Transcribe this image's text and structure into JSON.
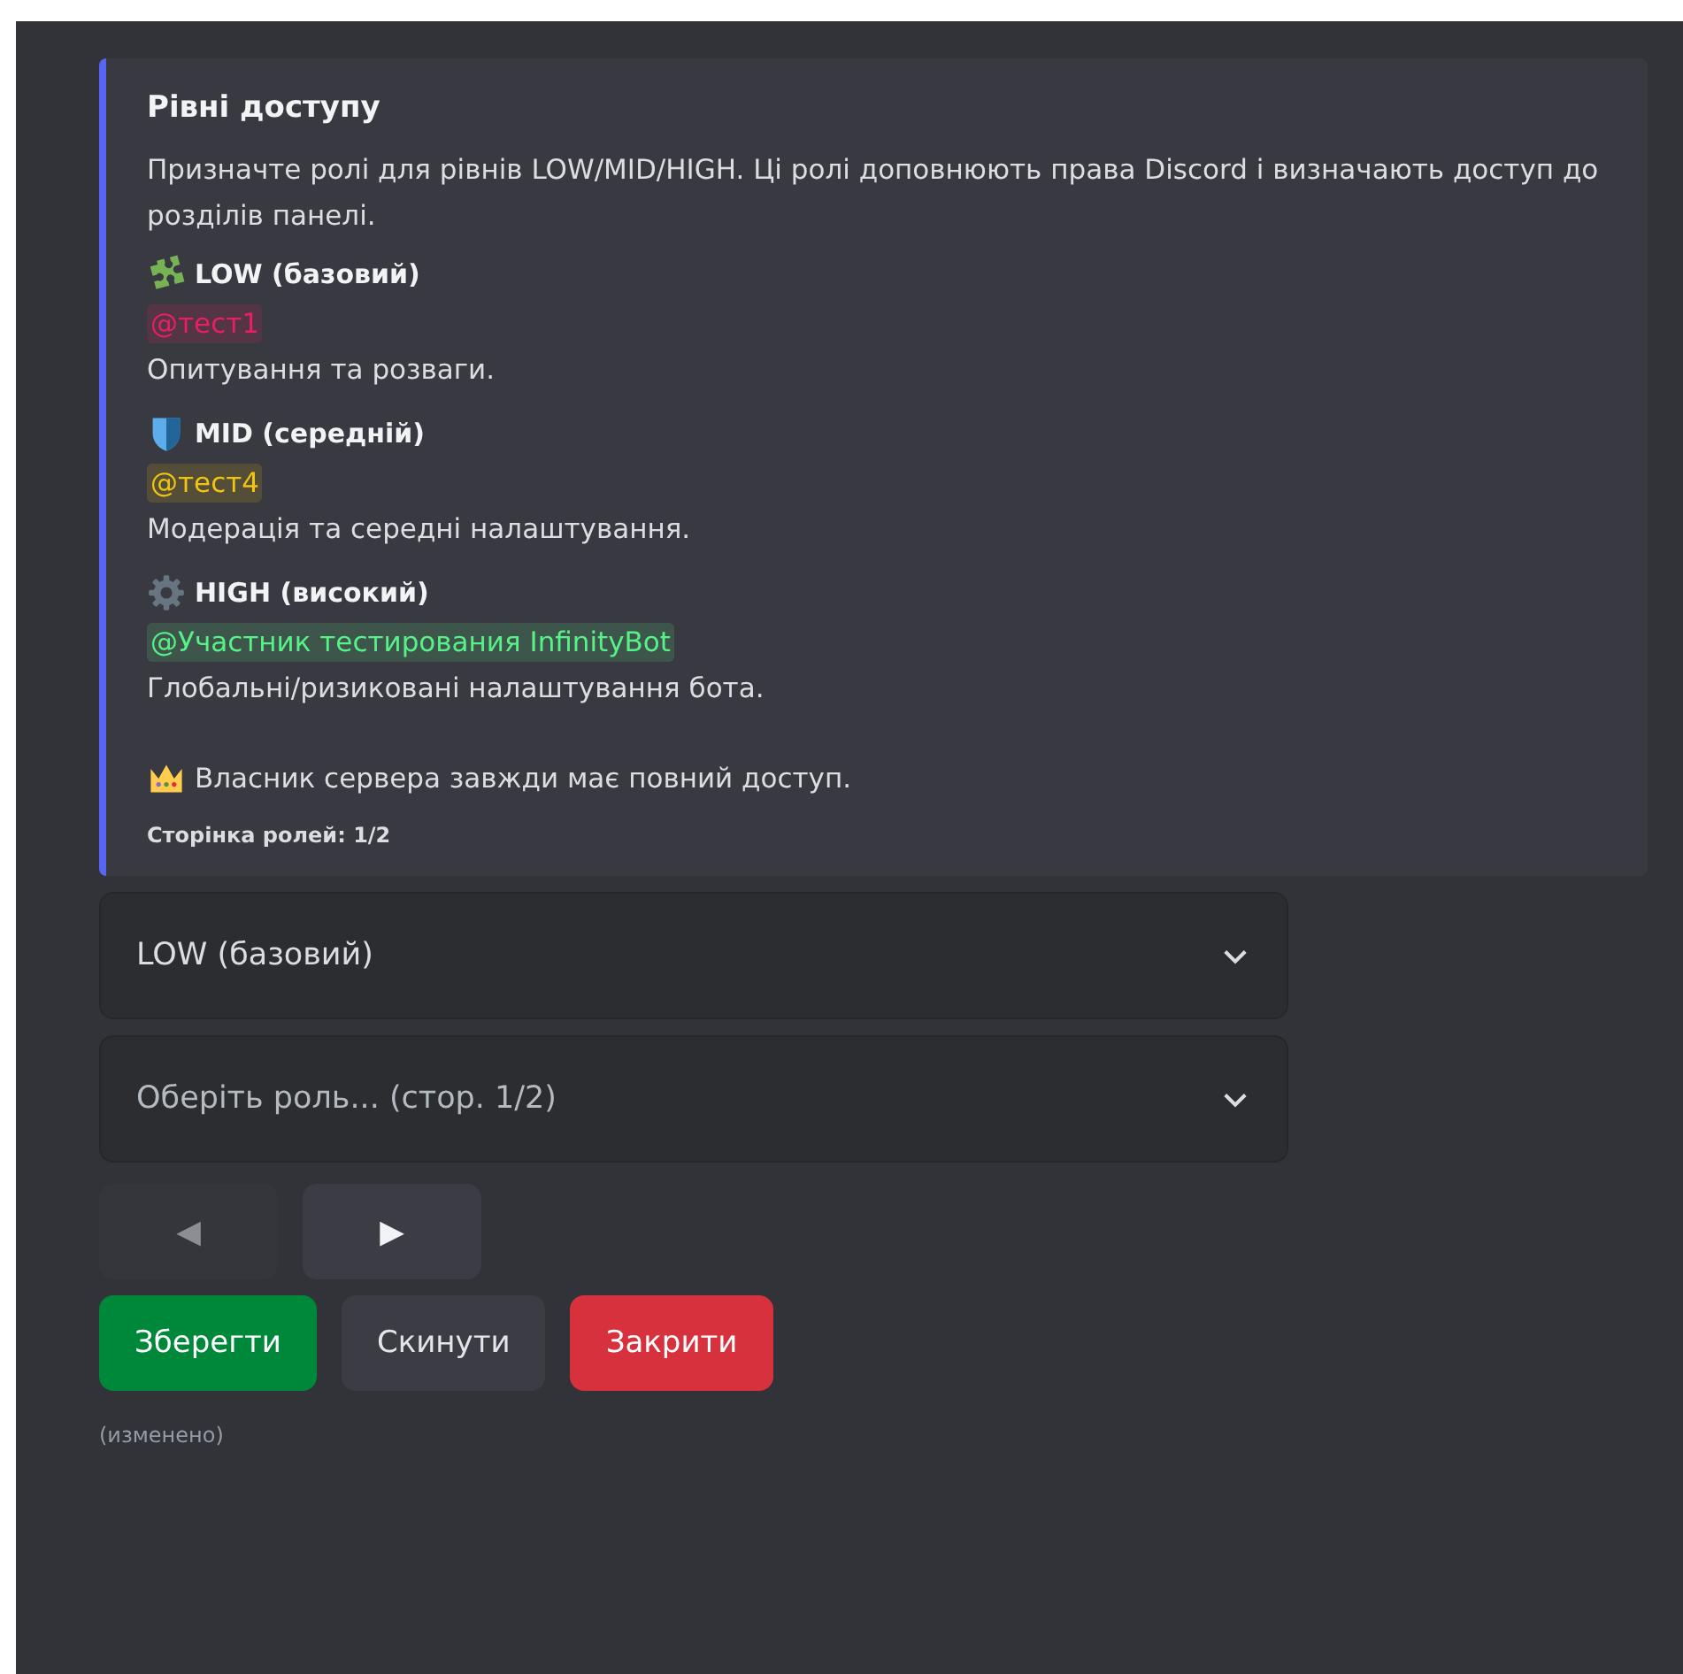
{
  "embed": {
    "title": "Рівні доступу",
    "description": "Призначте ролі для рівнів LOW/MID/HIGH. Ці ролі доповнюють права Discord і визначають доступ до розділів панелі.",
    "levels": [
      {
        "kind": "puzzle",
        "name": "LOW (базовий)",
        "role": "@тест1",
        "color": "#e91e63",
        "text": "Опитування та розваги."
      },
      {
        "kind": "shield",
        "name": "MID (середній)",
        "role": "@тест4",
        "color": "#f1c40f",
        "text": "Модерація та середні налаштування."
      },
      {
        "kind": "gear",
        "name": "HIGH (високий)",
        "role": "@Участник тестирования InfinityBot",
        "color": "#57f287",
        "text": "Глобальні/ризиковані налаштування бота."
      }
    ],
    "owner_note": "Власник сервера завжди має повний доступ.",
    "footer": "Сторінка ролей: 1/2"
  },
  "selects": [
    {
      "value": "LOW (базовий)"
    },
    {
      "placeholder": "Оберіть роль... (стор. 1/2)"
    }
  ],
  "pager": [
    {
      "label": "◀",
      "disabled": true
    },
    {
      "label": "▶",
      "disabled": false
    }
  ],
  "buttons": [
    {
      "label": "Зберегти",
      "kind": "success"
    },
    {
      "label": "Скинути",
      "kind": "secondary"
    },
    {
      "label": "Закрити",
      "kind": "danger"
    }
  ],
  "edited": "(изменено)"
}
